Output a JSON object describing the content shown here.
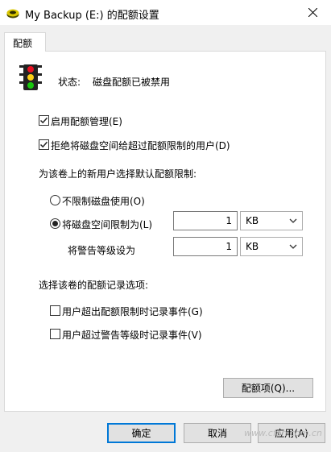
{
  "window": {
    "title": "My Backup (E:) 的配额设置"
  },
  "tabs": [
    {
      "label": "配额"
    }
  ],
  "status": {
    "label": "状态:",
    "value": "磁盘配额已被禁用"
  },
  "options": {
    "enable_quota": {
      "label": "启用配额管理(E)",
      "checked": true
    },
    "deny_space": {
      "label": "拒绝将磁盘空间给超过配额限制的用户(D)",
      "checked": true
    }
  },
  "default_limit": {
    "heading": "为该卷上的新用户选择默认配额限制:",
    "no_limit": {
      "label": "不限制磁盘使用(O)",
      "selected": false
    },
    "limit": {
      "label": "将磁盘空间限制为(L)",
      "selected": true,
      "value": "1",
      "unit": "KB"
    },
    "warning": {
      "label": "将警告等级设为",
      "value": "1",
      "unit": "KB"
    }
  },
  "logging": {
    "heading": "选择该卷的配额记录选项:",
    "log_limit": {
      "label": "用户超出配额限制时记录事件(G)",
      "checked": false
    },
    "log_warning": {
      "label": "用户超过警告等级时记录事件(V)",
      "checked": false
    }
  },
  "buttons": {
    "quota_entries": "配额项(Q)...",
    "ok": "确定",
    "cancel": "取消",
    "apply": "应用(A)"
  },
  "watermark": "www.cfan.com.cn",
  "colors": {
    "accent": "#0078d7",
    "red_light": "#e81123",
    "yellow_light": "#fcd116",
    "green_light": "#16c60c"
  }
}
